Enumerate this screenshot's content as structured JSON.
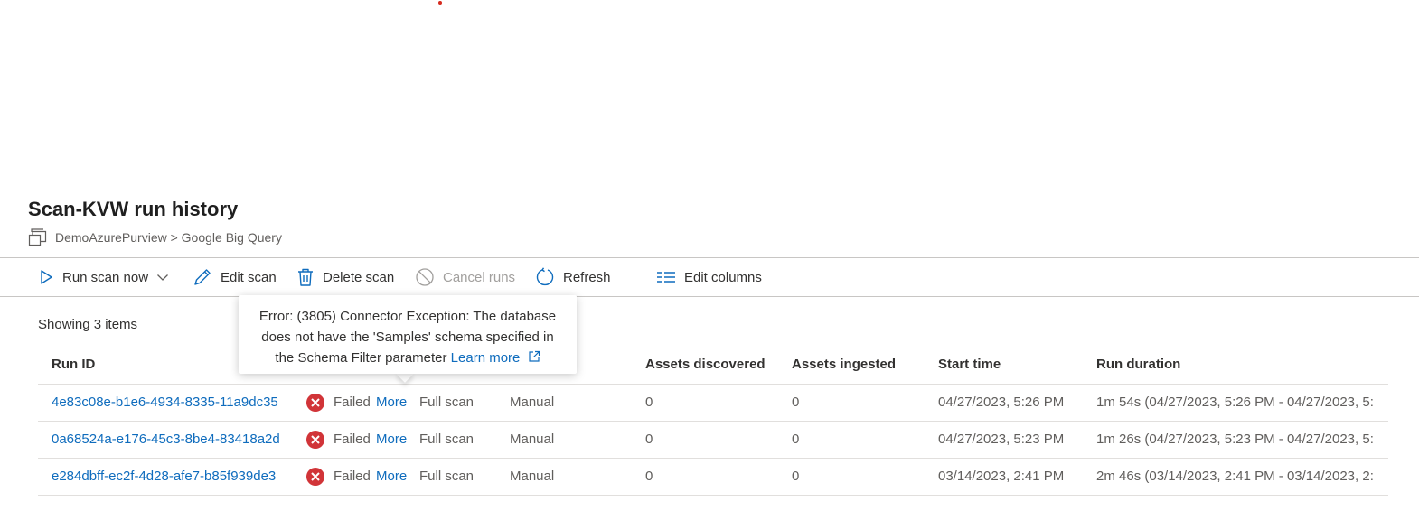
{
  "page": {
    "title": "Scan-KVW run history",
    "breadcrumb": "DemoAzurePurview > Google Big Query",
    "showing": "Showing 3 items"
  },
  "toolbar": {
    "run_scan_now": "Run scan now",
    "edit_scan": "Edit scan",
    "delete_scan": "Delete scan",
    "cancel_runs": "Cancel runs",
    "refresh": "Refresh",
    "edit_columns": "Edit columns"
  },
  "tooltip": {
    "text": "Error: (3805) Connector Exception: The database does not have the 'Samples' schema specified in the Schema Filter parameter",
    "learn_more": "Learn more"
  },
  "table": {
    "headers": {
      "run_id": "Run ID",
      "assets_discovered": "Assets discovered",
      "assets_ingested": "Assets ingested",
      "start_time": "Start time",
      "run_duration": "Run duration"
    },
    "rows": [
      {
        "run_id": "4e83c08e-b1e6-4934-8335-11a9dc35",
        "status": "Failed",
        "more": "More",
        "scan_type": "Full scan",
        "trigger": "Manual",
        "assets_discovered": "0",
        "assets_ingested": "0",
        "start_time": "04/27/2023, 5:26 PM",
        "run_duration": "1m 54s (04/27/2023, 5:26 PM - 04/27/2023, 5:"
      },
      {
        "run_id": "0a68524a-e176-45c3-8be4-83418a2d",
        "status": "Failed",
        "more": "More",
        "scan_type": "Full scan",
        "trigger": "Manual",
        "assets_discovered": "0",
        "assets_ingested": "0",
        "start_time": "04/27/2023, 5:23 PM",
        "run_duration": "1m 26s (04/27/2023, 5:23 PM - 04/27/2023, 5:"
      },
      {
        "run_id": "e284dbff-ec2f-4d28-afe7-b85f939de3",
        "status": "Failed",
        "more": "More",
        "scan_type": "Full scan",
        "trigger": "Manual",
        "assets_discovered": "0",
        "assets_ingested": "0",
        "start_time": "03/14/2023, 2:41 PM",
        "run_duration": "2m 46s (03/14/2023, 2:41 PM - 03/14/2023, 2:"
      }
    ]
  },
  "colors": {
    "link": "#0f6cbd",
    "error": "#d13438",
    "border": "#c8c6c4"
  }
}
